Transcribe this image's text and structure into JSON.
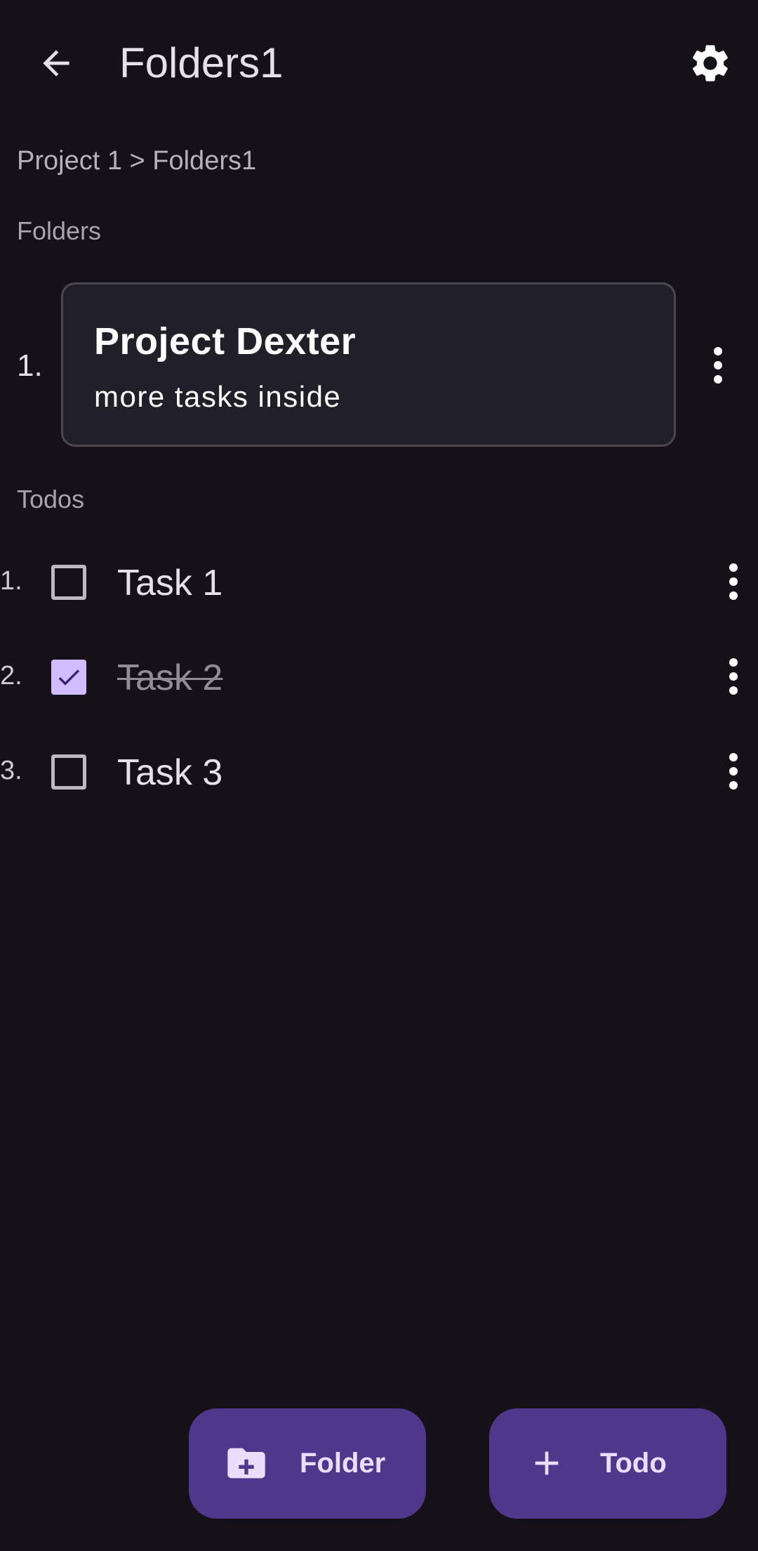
{
  "appbar": {
    "title": "Folders1",
    "back_icon": "arrow-back-icon",
    "settings_icon": "gear-icon"
  },
  "breadcrumb": "Project 1 > Folders1",
  "sections": {
    "folders_label": "Folders",
    "todos_label": "Todos"
  },
  "folders": [
    {
      "index": "1.",
      "name": "Project Dexter",
      "description": "more tasks inside"
    }
  ],
  "todos": [
    {
      "index": "1.",
      "label": "Task 1",
      "checked": false
    },
    {
      "index": "2.",
      "label": "Task 2",
      "checked": true
    },
    {
      "index": "3.",
      "label": "Task 3",
      "checked": false
    }
  ],
  "fabs": {
    "folder_label": "Folder",
    "folder_icon": "create-folder-icon",
    "todo_label": "Todo",
    "todo_icon": "plus-icon"
  },
  "colors": {
    "background": "#141218",
    "card": "#211f27",
    "accent": "#d0bcff",
    "fab": "#4f378b"
  }
}
